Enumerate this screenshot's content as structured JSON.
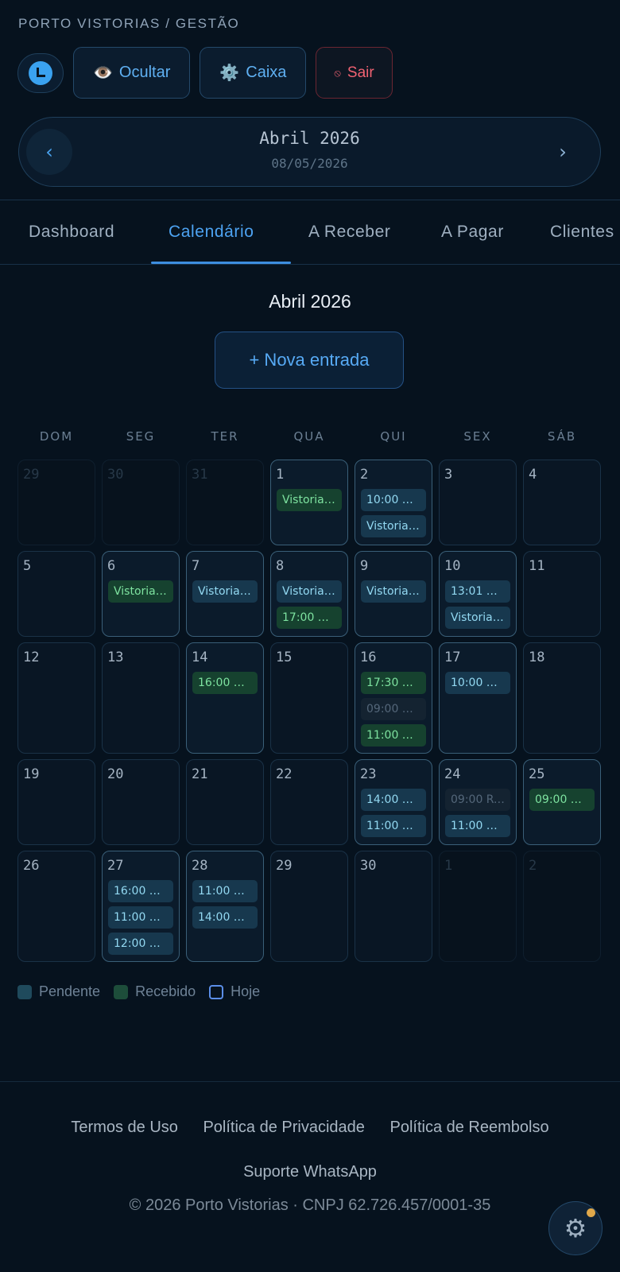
{
  "header": {
    "brand": "PORTO VISTORIAS / GESTÃO",
    "buttons": [
      {
        "label": "Ocultar",
        "icon": "👁️"
      },
      {
        "label": "Caixa",
        "icon": "⚙️"
      },
      {
        "label": "Sair",
        "icon": "⦸"
      }
    ]
  },
  "month_nav": {
    "title": "Abril 2026",
    "date": "08/05/2026",
    "prev_icon": "‹",
    "next_icon": "›"
  },
  "tabs": [
    "Dashboard",
    "Calendário",
    "A Receber",
    "A Pagar",
    "Clientes"
  ],
  "active_tab": "Calendário",
  "calendar": {
    "title": "Abril 2026",
    "new_entry": "+ Nova entrada",
    "weekdays": [
      "DOM",
      "SEG",
      "TER",
      "QUA",
      "QUI",
      "SEX",
      "SÁB"
    ],
    "weeks": [
      [
        {
          "day": "29",
          "muted": true,
          "events": []
        },
        {
          "day": "30",
          "muted": true,
          "events": []
        },
        {
          "day": "31",
          "muted": true,
          "events": []
        },
        {
          "day": "1",
          "events": [
            {
              "text": "Vistoria ...",
              "status": "rec"
            }
          ]
        },
        {
          "day": "2",
          "events": [
            {
              "text": "10:00 Vis...",
              "status": "pend"
            },
            {
              "text": "Vistoria ...",
              "status": "pend"
            }
          ]
        },
        {
          "day": "3",
          "events": []
        },
        {
          "day": "4",
          "events": []
        }
      ],
      [
        {
          "day": "5",
          "events": []
        },
        {
          "day": "6",
          "events": [
            {
              "text": "Vistoria ...",
              "status": "rec"
            }
          ]
        },
        {
          "day": "7",
          "events": [
            {
              "text": "Vistoria s...",
              "status": "pend"
            }
          ]
        },
        {
          "day": "8",
          "events": [
            {
              "text": "Vistoria s...",
              "status": "pend"
            },
            {
              "text": "17:00 Vis...",
              "status": "rec"
            }
          ]
        },
        {
          "day": "9",
          "events": [
            {
              "text": "Vistoria r...",
              "status": "pend"
            }
          ]
        },
        {
          "day": "10",
          "events": [
            {
              "text": "13:01 Vist...",
              "status": "pend"
            },
            {
              "text": "Vistoria ...",
              "status": "pend"
            }
          ]
        },
        {
          "day": "11",
          "events": []
        }
      ],
      [
        {
          "day": "12",
          "events": []
        },
        {
          "day": "13",
          "events": []
        },
        {
          "day": "14",
          "events": [
            {
              "text": "16:00 Vis...",
              "status": "rec"
            }
          ]
        },
        {
          "day": "15",
          "events": []
        },
        {
          "day": "16",
          "events": [
            {
              "text": "17:30 Vist...",
              "status": "rec"
            },
            {
              "text": "09:00 Vi...",
              "status": "dim"
            },
            {
              "text": "11:00 Co...",
              "status": "rec"
            }
          ]
        },
        {
          "day": "17",
          "events": [
            {
              "text": "10:00 Vis...",
              "status": "pend"
            }
          ]
        },
        {
          "day": "18",
          "events": []
        }
      ],
      [
        {
          "day": "19",
          "events": []
        },
        {
          "day": "20",
          "events": []
        },
        {
          "day": "21",
          "events": []
        },
        {
          "day": "22",
          "events": []
        },
        {
          "day": "23",
          "events": [
            {
              "text": "14:00 Vis...",
              "status": "pend"
            },
            {
              "text": "11:00 Vist...",
              "status": "pend"
            }
          ]
        },
        {
          "day": "24",
          "events": [
            {
              "text": "09:00 Re...",
              "status": "dim"
            },
            {
              "text": "11:00 Vist...",
              "status": "pend"
            }
          ]
        },
        {
          "day": "25",
          "events": [
            {
              "text": "09:00 Vi...",
              "status": "rec"
            }
          ]
        }
      ],
      [
        {
          "day": "26",
          "events": []
        },
        {
          "day": "27",
          "events": [
            {
              "text": "16:00 Vis...",
              "status": "pend"
            },
            {
              "text": "11:00 Vist...",
              "status": "pend"
            },
            {
              "text": "12:00 Vis...",
              "status": "pend"
            }
          ]
        },
        {
          "day": "28",
          "events": [
            {
              "text": "11:00 Vist...",
              "status": "pend"
            },
            {
              "text": "14:00 Vis...",
              "status": "pend"
            }
          ]
        },
        {
          "day": "29",
          "events": []
        },
        {
          "day": "30",
          "events": []
        },
        {
          "day": "1",
          "muted": true,
          "events": []
        },
        {
          "day": "2",
          "muted": true,
          "events": []
        }
      ]
    ]
  },
  "legend": [
    {
      "label": "Pendente",
      "color": "#1f4a5c"
    },
    {
      "label": "Recebido",
      "color": "#1d4d3a"
    },
    {
      "label": "Hoje",
      "color": "#5b8ee8"
    }
  ],
  "footer": {
    "links": [
      "Termos de Uso",
      "Política de Privacidade",
      "Política de Reembolso"
    ],
    "support": "Suporte WhatsApp",
    "copyright": "© 2026 Porto Vistorias · CNPJ 62.726.457/0001-35",
    "settings_icon": "⚙"
  }
}
